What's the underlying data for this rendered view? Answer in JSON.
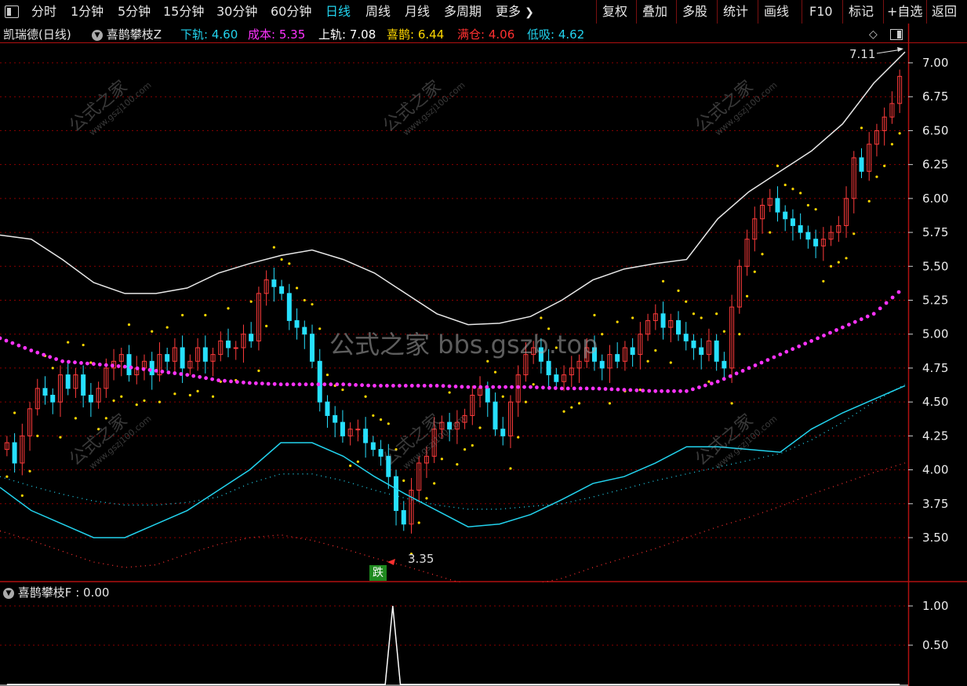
{
  "toolbar": {
    "toggle_icon": "panel-toggle-icon",
    "periods": [
      "分时",
      "1分钟",
      "5分钟",
      "15分钟",
      "30分钟",
      "60分钟",
      "日线",
      "周线",
      "月线",
      "多周期",
      "更多"
    ],
    "active_period": "日线",
    "more_icon": "chevron-right-icon",
    "actions": [
      "复权",
      "叠加",
      "多股",
      "统计",
      "画线",
      "F10",
      "标记",
      "+自选",
      "返回"
    ]
  },
  "main_header": {
    "stock": "凯瑞德(日线)",
    "indicator": "喜鹊攀枝Z",
    "items": [
      {
        "label": "下轨",
        "value": "4.60",
        "color": "#22d3ee"
      },
      {
        "label": "成本",
        "value": "5.35",
        "color": "#ff33ff"
      },
      {
        "label": "上轨",
        "value": "7.08",
        "color": "#ffffff"
      },
      {
        "label": "喜鹊",
        "value": "6.44",
        "color": "#ffd700"
      },
      {
        "label": "满仓",
        "value": "4.06",
        "color": "#ff3030"
      },
      {
        "label": "低吸",
        "value": "4.62",
        "color": "#22d3ee"
      }
    ]
  },
  "sub_header": {
    "indicator": "喜鹊攀枝F",
    "value": "0.00"
  },
  "chart_data": [
    {
      "type": "candlestick",
      "y_ticks": [
        "7.00",
        "6.75",
        "6.50",
        "6.25",
        "6.00",
        "5.75",
        "5.50",
        "5.25",
        "5.00",
        "4.75",
        "4.50",
        "4.25",
        "4.00",
        "3.75",
        "3.50"
      ],
      "ylim": [
        3.4,
        7.2
      ],
      "annotations": [
        {
          "text": "7.11"
        },
        {
          "text": "3.35"
        },
        {
          "text": "跌"
        }
      ],
      "close_approx": [
        4.2,
        4.05,
        4.25,
        4.45,
        4.6,
        4.55,
        4.5,
        4.7,
        4.6,
        4.7,
        4.55,
        4.5,
        4.6,
        4.75,
        4.8,
        4.85,
        4.7,
        4.75,
        4.8,
        4.7,
        4.85,
        4.8,
        4.9,
        4.75,
        4.8,
        4.9,
        4.8,
        4.85,
        4.95,
        4.9,
        4.9,
        5.0,
        4.95,
        5.3,
        5.4,
        5.35,
        5.3,
        5.1,
        5.05,
        5.0,
        4.8,
        4.5,
        4.4,
        4.35,
        4.25,
        4.3,
        4.3,
        4.2,
        4.15,
        4.1,
        3.95,
        3.7,
        3.6,
        3.85,
        4.05,
        4.1,
        4.3,
        4.35,
        4.3,
        4.35,
        4.4,
        4.55,
        4.6,
        4.5,
        4.3,
        4.25,
        4.5,
        4.7,
        4.85,
        4.9,
        4.8,
        4.7,
        4.65,
        4.7,
        4.75,
        4.8,
        4.9,
        4.8,
        4.75,
        4.85,
        4.8,
        4.9,
        4.85,
        5.0,
        5.1,
        5.15,
        5.05,
        5.1,
        5.0,
        4.95,
        4.9,
        4.85,
        4.95,
        4.8,
        4.75,
        5.2,
        5.5,
        5.7,
        5.85,
        5.95,
        6.0,
        5.9,
        5.85,
        5.8,
        5.75,
        5.7,
        5.65,
        5.7,
        5.75,
        5.8,
        6.0,
        6.3,
        6.2,
        6.4,
        6.5,
        6.6,
        6.7,
        6.9
      ],
      "series": [
        {
          "name": "上轨",
          "values": [
            5.73,
            5.7,
            5.55,
            5.38,
            5.3,
            5.3,
            5.34,
            5.45,
            5.52,
            5.58,
            5.62,
            5.55,
            5.45,
            5.3,
            5.15,
            5.07,
            5.08,
            5.13,
            5.25,
            5.4,
            5.48,
            5.52,
            5.55,
            5.85,
            6.05,
            6.2,
            6.35,
            6.55,
            6.85,
            7.08
          ]
        },
        {
          "name": "成本",
          "values": [
            4.97,
            4.88,
            4.8,
            4.78,
            4.76,
            4.73,
            4.7,
            4.66,
            4.64,
            4.63,
            4.63,
            4.63,
            4.62,
            4.62,
            4.62,
            4.61,
            4.61,
            4.61,
            4.6,
            4.6,
            4.59,
            4.58,
            4.58,
            4.65,
            4.75,
            4.85,
            4.95,
            5.05,
            5.15,
            5.35
          ]
        },
        {
          "name": "下轨",
          "values": [
            3.87,
            3.7,
            3.6,
            3.5,
            3.5,
            3.6,
            3.7,
            3.85,
            4.0,
            4.2,
            4.2,
            4.1,
            3.95,
            3.82,
            3.7,
            3.58,
            3.6,
            3.67,
            3.78,
            3.9,
            3.95,
            4.05,
            4.17,
            4.17,
            4.15,
            4.13,
            4.3,
            4.42,
            4.52,
            4.62
          ]
        },
        {
          "name": "低吸",
          "values": [
            3.95,
            3.88,
            3.82,
            3.77,
            3.74,
            3.74,
            3.76,
            3.8,
            3.9,
            3.97,
            3.97,
            3.92,
            3.85,
            3.79,
            3.74,
            3.71,
            3.71,
            3.73,
            3.75,
            3.8,
            3.86,
            3.92,
            3.97,
            4.02,
            4.07,
            4.12,
            4.22,
            4.35,
            4.5,
            4.63
          ]
        },
        {
          "name": "满仓",
          "values": [
            3.55,
            3.48,
            3.4,
            3.32,
            3.28,
            3.3,
            3.38,
            3.45,
            3.5,
            3.52,
            3.48,
            3.42,
            3.35,
            3.29,
            3.22,
            3.15,
            3.12,
            3.15,
            3.2,
            3.28,
            3.35,
            3.42,
            3.5,
            3.58,
            3.65,
            3.73,
            3.82,
            3.9,
            3.98,
            4.05
          ]
        }
      ]
    },
    {
      "type": "line",
      "y_ticks": [
        "1.00",
        "0.50"
      ],
      "ylim": [
        0,
        1.2
      ],
      "series": [
        {
          "name": "喜鹊攀枝F",
          "values": [
            0,
            0,
            0,
            0,
            0,
            0,
            0,
            0,
            0,
            0,
            0,
            0,
            0,
            0,
            0,
            0,
            0,
            0,
            0,
            0,
            0,
            0,
            0,
            0,
            0,
            0,
            0,
            0,
            0,
            0,
            0,
            0,
            0,
            0,
            0,
            0,
            0,
            0,
            0,
            0,
            0,
            0,
            0,
            0,
            0,
            0,
            0,
            0,
            0,
            0,
            0,
            1,
            0,
            0,
            0,
            0,
            0,
            0,
            0,
            0,
            0,
            0,
            0,
            0,
            0,
            0,
            0,
            0,
            0,
            0,
            0,
            0,
            0,
            0,
            0,
            0,
            0,
            0,
            0,
            0,
            0,
            0,
            0,
            0,
            0,
            0,
            0,
            0,
            0,
            0,
            0,
            0,
            0,
            0,
            0,
            0,
            0,
            0,
            0,
            0,
            0,
            0,
            0,
            0,
            0,
            0,
            0,
            0,
            0,
            0,
            0,
            0,
            0,
            0,
            0,
            0,
            0,
            0,
            0
          ]
        }
      ]
    }
  ],
  "watermarks": {
    "site_cn": "公式之家",
    "site_en": "www.gszj100.com",
    "center": "公式之家 bbs.gszb.top"
  },
  "colors": {
    "up": "#ff3b3b",
    "down": "#27e0ff",
    "grid": "#8a0000",
    "axis": "#b01010"
  }
}
